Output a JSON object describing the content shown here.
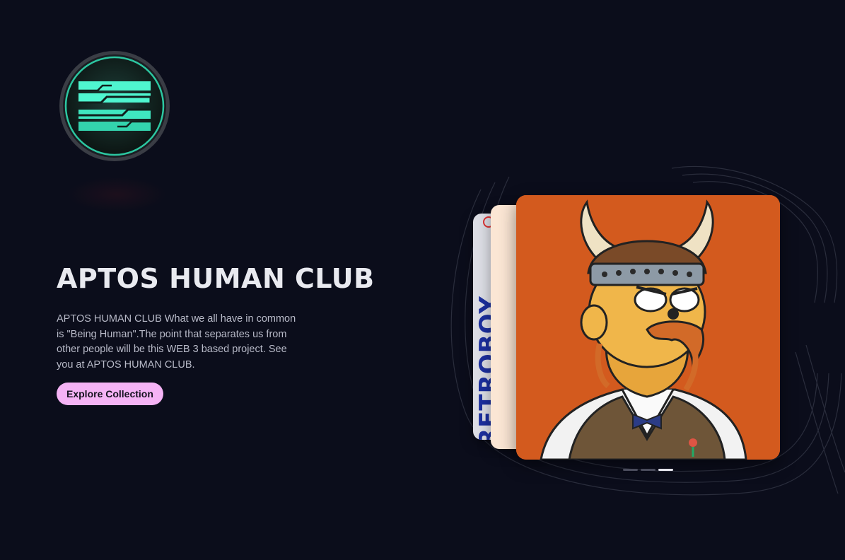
{
  "hero": {
    "title": "APTOS HUMAN CLUB",
    "description": "APTOS HUMAN CLUB What we all have in common is \"Being Human\".The point that separates us from other people will be this WEB 3 based project. See you at APTOS HUMAN CLUB.",
    "cta_label": "Explore Collection"
  },
  "logo": {
    "icon": "aptos-logo-icon",
    "accent": "#3ef2c4"
  },
  "carousel": {
    "back_card_text": "RETROBOY",
    "slide_count": 3,
    "active_slide": 3,
    "slide_colors": [
      "#dcdde4",
      "#fbe6d4",
      "#d35a1e"
    ]
  },
  "colors": {
    "background": "#0b0d1b",
    "button": "#f5b3f5",
    "title": "#e9eaf0"
  }
}
